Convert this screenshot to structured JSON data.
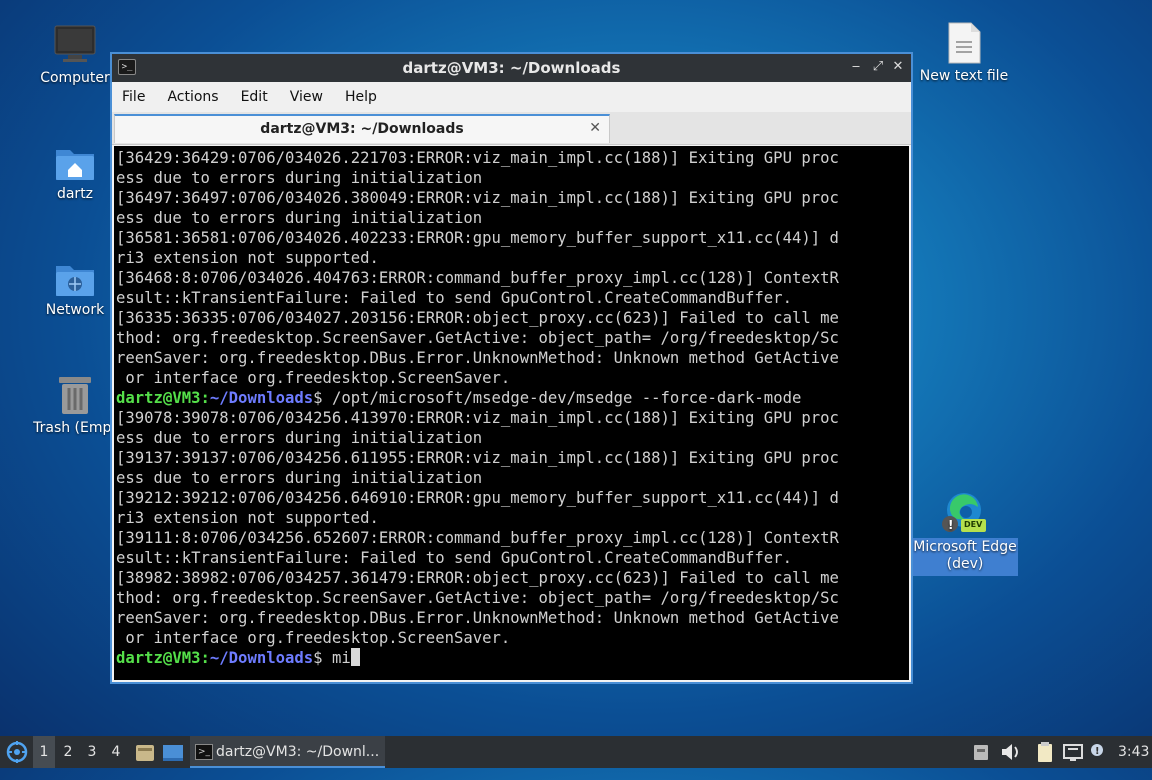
{
  "desktop": {
    "icons": [
      {
        "label": "Computer"
      },
      {
        "label": "dartz"
      },
      {
        "label": "Network"
      },
      {
        "label": "Trash (Empt"
      },
      {
        "label": "New text file"
      },
      {
        "label": "Microsoft Edge (dev)",
        "badge": "DEV"
      }
    ]
  },
  "window": {
    "title": "dartz@VM3: ~/Downloads",
    "menu": [
      "File",
      "Actions",
      "Edit",
      "View",
      "Help"
    ],
    "tab_label": "dartz@VM3: ~/Downloads",
    "tab_close": "✕",
    "controls": {
      "minimize": "‒",
      "maximize": "⤢",
      "close": "✕"
    }
  },
  "terminal": {
    "lines": [
      "[36429:36429:0706/034026.221703:ERROR:viz_main_impl.cc(188)] Exiting GPU proc",
      "ess due to errors during initialization",
      "[36497:36497:0706/034026.380049:ERROR:viz_main_impl.cc(188)] Exiting GPU proc",
      "ess due to errors during initialization",
      "[36581:36581:0706/034026.402233:ERROR:gpu_memory_buffer_support_x11.cc(44)] d",
      "ri3 extension not supported.",
      "[36468:8:0706/034026.404763:ERROR:command_buffer_proxy_impl.cc(128)] ContextR",
      "esult::kTransientFailure: Failed to send GpuControl.CreateCommandBuffer.",
      "[36335:36335:0706/034027.203156:ERROR:object_proxy.cc(623)] Failed to call me",
      "thod: org.freedesktop.ScreenSaver.GetActive: object_path= /org/freedesktop/Sc",
      "reenSaver: org.freedesktop.DBus.Error.UnknownMethod: Unknown method GetActive",
      " or interface org.freedesktop.ScreenSaver."
    ],
    "prompt_user": "dartz@VM3",
    "prompt_sep": ":",
    "prompt_path": "~/Downloads",
    "prompt_end": "$ ",
    "command": "/opt/microsoft/msedge-dev/msedge --force-dark-mode",
    "lines2": [
      "[39078:39078:0706/034256.413970:ERROR:viz_main_impl.cc(188)] Exiting GPU proc",
      "ess due to errors during initialization",
      "[39137:39137:0706/034256.611955:ERROR:viz_main_impl.cc(188)] Exiting GPU proc",
      "ess due to errors during initialization",
      "[39212:39212:0706/034256.646910:ERROR:gpu_memory_buffer_support_x11.cc(44)] d",
      "ri3 extension not supported.",
      "[39111:8:0706/034256.652607:ERROR:command_buffer_proxy_impl.cc(128)] ContextR",
      "esult::kTransientFailure: Failed to send GpuControl.CreateCommandBuffer.",
      "[38982:38982:0706/034257.361479:ERROR:object_proxy.cc(623)] Failed to call me",
      "thod: org.freedesktop.ScreenSaver.GetActive: object_path= /org/freedesktop/Sc",
      "reenSaver: org.freedesktop.DBus.Error.UnknownMethod: Unknown method GetActive",
      " or interface org.freedesktop.ScreenSaver."
    ],
    "current_input": "mi"
  },
  "taskbar": {
    "workspaces": [
      "1",
      "2",
      "3",
      "4"
    ],
    "active_workspace": "1",
    "task_label": "dartz@VM3: ~/Downl...",
    "clock": "3:43"
  },
  "colors": {
    "accent": "#4a8fd6",
    "prompt_user": "#55e04a",
    "prompt_path": "#6e7cff"
  }
}
